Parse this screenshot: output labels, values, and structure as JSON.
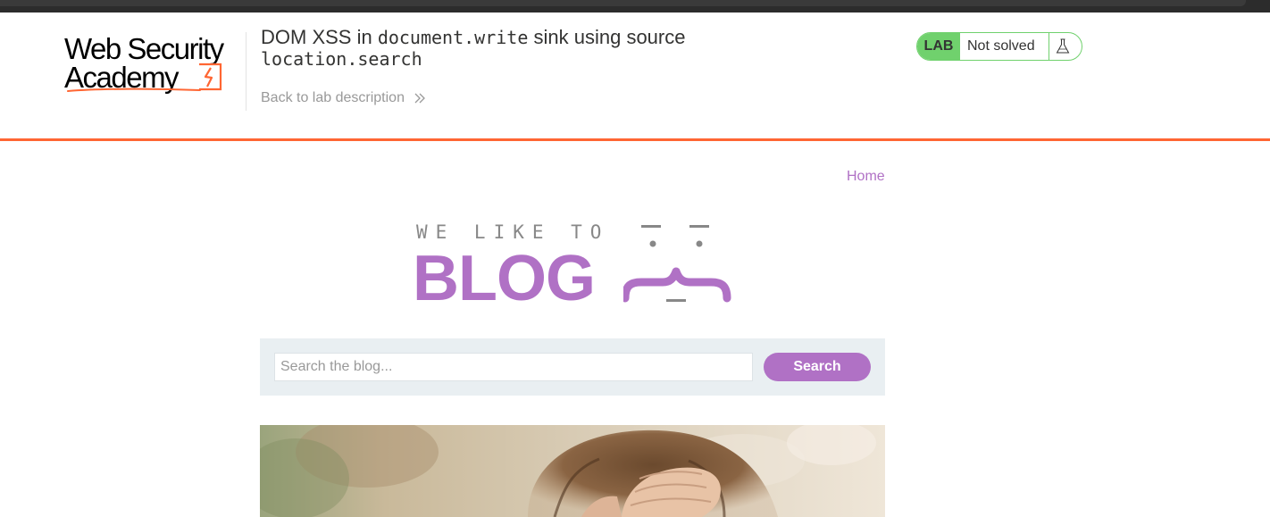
{
  "academy": {
    "logo_line1": "Web Security",
    "logo_line2": "Academy",
    "title_prefix": "DOM XSS in ",
    "title_code1": "document.write",
    "title_middle": " sink using source ",
    "title_code2": "location.search",
    "back_link": "Back to lab description",
    "lab_badge": "LAB",
    "lab_status": "Not solved"
  },
  "blog": {
    "nav_home": "Home",
    "banner_tagline": "WE LIKE TO",
    "banner_title": "BLOG",
    "search_placeholder": "Search the blog...",
    "search_value": "",
    "search_button": "Search"
  },
  "colors": {
    "brand_orange": "#ff6633",
    "blog_purple": "#b071c5",
    "lab_green": "#70d16d",
    "search_panel_bg": "#e9eff2"
  },
  "icons": {
    "back_chevron": "double-chevron-right-icon",
    "lab_flask": "flask-icon",
    "logo_mark": "lightning-bracket-icon"
  }
}
